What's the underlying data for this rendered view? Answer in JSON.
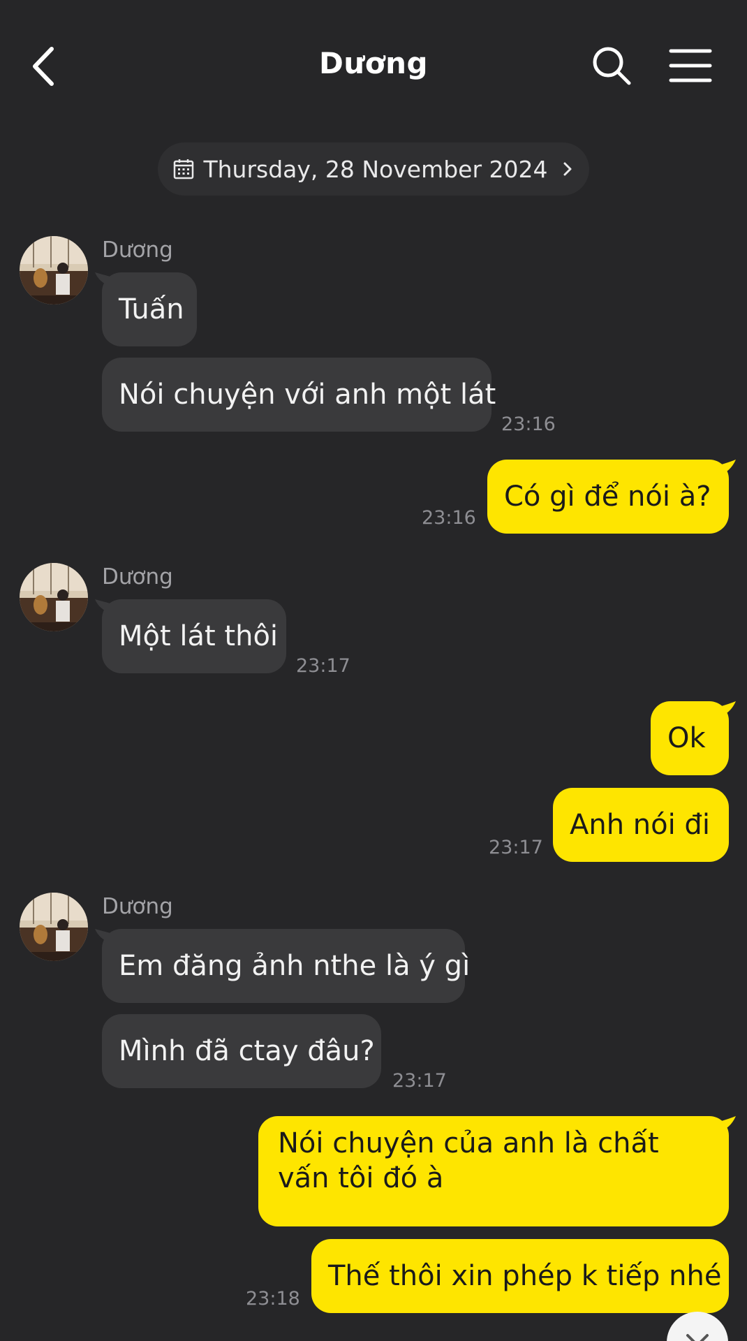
{
  "header": {
    "title": "Dương",
    "back_icon": "chevron-left-icon",
    "search_icon": "search-icon",
    "menu_icon": "hamburger-menu-icon"
  },
  "date_divider": {
    "label": "Thursday, 28 November 2024",
    "icon": "calendar-icon"
  },
  "colors": {
    "background": "#262628",
    "incoming_bubble": "#3a3a3c",
    "outgoing_bubble": "#fee500",
    "timestamp": "#8e8e93"
  },
  "messages": [
    {
      "sender": "Dương",
      "text": "Tuấn"
    },
    {
      "text": "Nói chuyện với anh một lát",
      "time": "23:16"
    },
    {
      "text": "Có gì để nói à?",
      "time": "23:16"
    },
    {
      "sender": "Dương",
      "text": "Một lát thôi",
      "time": "23:17"
    },
    {
      "text": "Ok"
    },
    {
      "text": "Anh nói đi",
      "time": "23:17"
    },
    {
      "sender": "Dương",
      "text": "Em đăng ảnh nthe là ý gì"
    },
    {
      "text": "Mình đã ctay đâu?",
      "time": "23:17"
    },
    {
      "text": "Nói chuyện của anh là chất vấn tôi đó à"
    },
    {
      "text": "Thế thôi xin phép k tiếp nhé",
      "time": "23:18"
    }
  ]
}
